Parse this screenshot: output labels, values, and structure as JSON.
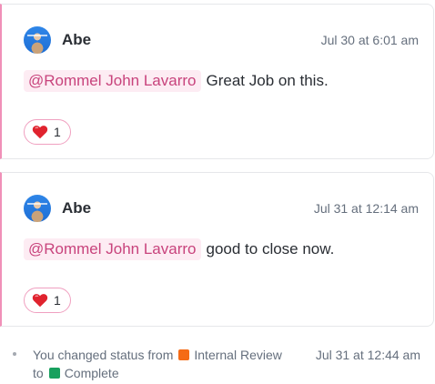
{
  "comments": [
    {
      "author": "Abe",
      "timestamp": "Jul 30 at 6:01 am",
      "mention": "@Rommel John Lavarro",
      "text": "Great Job on this.",
      "reaction": {
        "emoji": "heart",
        "count": "1"
      }
    },
    {
      "author": "Abe",
      "timestamp": "Jul 31 at 12:14 am",
      "mention": "@Rommel John Lavarro",
      "text": "good to close now.",
      "reaction": {
        "emoji": "heart",
        "count": "1"
      }
    }
  ],
  "activity": {
    "prefix": "You changed status from",
    "from_status": {
      "label": "Internal Review",
      "color": "#f56b16"
    },
    "connector": "to",
    "to_status": {
      "label": "Complete",
      "color": "#18a05e"
    },
    "timestamp": "Jul 31 at 12:44 am"
  },
  "colors": {
    "accent_border": "#f090b8",
    "mention_text": "#c8437c",
    "mention_bg": "#fdecf3",
    "heart": "#e0232e"
  }
}
